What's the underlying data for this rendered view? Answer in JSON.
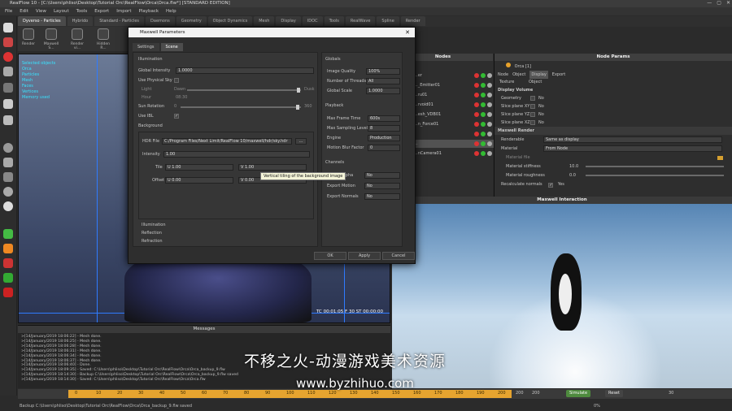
{
  "window": {
    "title": "RealFlow 10 - [C:\\Users\\phliso\\Desktop\\Tutorial Orc\\RealFlow\\Orca\\Orca.flw*] [STANDARD EDITION]",
    "controls": [
      "—",
      "▢",
      "✕"
    ]
  },
  "menu": [
    "File",
    "Edit",
    "View",
    "Layout",
    "Tools",
    "Export",
    "Import",
    "Playback",
    "Help"
  ],
  "tabs": [
    {
      "label": "Dyverso - Particles",
      "active": true
    },
    {
      "label": "Hybrido",
      "active": false
    },
    {
      "label": "Standard - Particles",
      "active": false
    },
    {
      "label": "Daemons",
      "active": false
    },
    {
      "label": "Geometry",
      "active": false
    },
    {
      "label": "Object Dynamics",
      "active": false
    },
    {
      "label": "Mesh",
      "active": false
    },
    {
      "label": "Display",
      "active": false
    },
    {
      "label": "IDOC",
      "active": false
    },
    {
      "label": "Tools",
      "active": false
    },
    {
      "label": "RealWave",
      "active": false
    },
    {
      "label": "Spline",
      "active": false
    },
    {
      "label": "Render",
      "active": false
    }
  ],
  "shelf": [
    "Render",
    "Maxwell S...",
    "Render vi...",
    "Hidden R..."
  ],
  "viewport": {
    "info_lines": [
      "Selected objects",
      "Orca",
      "Particles",
      "Mesh",
      "Faces",
      "Vertices",
      "Memory used"
    ],
    "timecode": "TC 00:01:05   F 30   ST 00:00:00"
  },
  "messages": {
    "title": "Messages",
    "lines": [
      ">[14/January/2019 18:06:22] - Mesh done.",
      ">[14/January/2019 18:06:25] - Mesh done.",
      ">[14/January/2019 18:06:28] - Mesh done.",
      ">[14/January/2019 18:06:31] - Mesh done.",
      ">[14/January/2019 18:06:34] - Mesh done.",
      ">[14/January/2019 18:06:37] - Mesh done.",
      ">[14/January/2019 18:06:40] - Done.",
      ">[14/January/2019 18:09:35] - Saved: C:\\Users\\phliso\\Desktop\\Tutorial Orc\\RealFlow\\Orca\\Orca_backup_9.flw",
      ">[14/January/2019 18:14:30] - Backup C:\\Users\\phliso\\Desktop\\Tutorial Orc\\RealFlow\\Orca\\Orca_backup_9.flw saved",
      ">[14/January/2019 18:14:30] - Saved: C:\\Users\\phliso\\Desktop\\Tutorial Orc\\RealFlow\\Orca\\Orca.flw"
    ]
  },
  "timeline": {
    "ticks": [
      "0",
      "10",
      "20",
      "30",
      "40",
      "50",
      "60",
      "70",
      "80",
      "90",
      "100",
      "110",
      "120",
      "130",
      "140",
      "150",
      "160",
      "170",
      "180",
      "190",
      "200"
    ],
    "end_labels": [
      "200",
      "200"
    ],
    "simulate_label": "Simulate",
    "reset_label": "Reset",
    "frame": "30",
    "percent": "0%"
  },
  "status": "Backup C:\\Users\\phliso\\Desktop\\Tutorial Orc\\RealFlow\\Orca\\Orca_backup_9.flw saved",
  "nodes": {
    "title": "Nodes",
    "items": [
      "...er",
      "..._Emitter01",
      "...ru01",
      "...rvoid01",
      "...esh_VDB01",
      "...n_Force01",
      "",
      "...",
      "...nCamera01"
    ],
    "selected_index": 7
  },
  "node_params": {
    "title": "Node Params",
    "node_name": "Orca [1]",
    "tabs": [
      "Node",
      "Object",
      "Display",
      "Export"
    ],
    "active_tab": "Display",
    "texture_label": "Texture",
    "texture_value": "Object",
    "rows": [
      {
        "label": "Geometry",
        "value": "No"
      },
      {
        "label": "Slice plane XY",
        "value": "No"
      },
      {
        "label": "Slice plane YZ",
        "value": "No"
      },
      {
        "label": "Slice plane XZ",
        "value": "No"
      }
    ],
    "display_volume": "Display Volume",
    "maxwell_render": "Maxwell Render",
    "renderable_label": "Renderable",
    "renderable_value": "Same as display",
    "material_label": "Material",
    "material_value": "From Node",
    "material_file_label": "Material file",
    "material_stiffness_label": "Material stiffness",
    "material_stiffness_value": "10.0",
    "material_roughness_label": "Material roughness",
    "material_roughness_value": "0.0",
    "recalculate_label": "Recalculate normals",
    "recalculate_value": "Yes"
  },
  "interaction": {
    "title": "Maxwell Interaction"
  },
  "watermark": {
    "line1": "不移之火-动漫游戏美术资源",
    "line2": "www.byzhihuo.com"
  },
  "dialog": {
    "title": "Maxwell Parameters",
    "tabs": [
      "Settings",
      "Scene"
    ],
    "active_tab": "Scene",
    "illumination": {
      "header": "Illumination",
      "global_intensity_label": "Global Intensity",
      "global_intensity_value": "1.0000",
      "physical_sky_label": "Use Physical Sky",
      "light_label": "Light",
      "dawn_label": "Dawn",
      "dusk_label": "Dusk",
      "hour_label": "Hour",
      "hour_value": "08:30",
      "sun_rotation_label": "Sun Rotation",
      "sun_rotation_min": "0",
      "sun_rotation_max": "360",
      "use_ibl_label": "Use IBL",
      "use_ibl_checked": "✓",
      "background_label": "Background",
      "hdr_file_label": "HDR File",
      "hdr_file_value": "C:/Program Files/Next Limit/RealFlow 10/maxwell/hdr/sky.hdr",
      "intensity_label": "Intensity",
      "intensity_value": "1.00",
      "tile_label": "Tile",
      "tile_u": "U 1.00",
      "tile_v": "V 1.00",
      "offset_label": "Offset",
      "offset_u": "U 0.00",
      "offset_v": "V 0.00",
      "sub_items": [
        "Illumination",
        "Reflection",
        "Refraction"
      ]
    },
    "tooltip": "Vertical tiling of the background image",
    "globals": {
      "header": "Globals",
      "image_quality_label": "Image Quality",
      "image_quality_value": "100%",
      "num_threads_label": "Number of Threads",
      "num_threads_value": "All",
      "global_scale_label": "Global Scale",
      "global_scale_value": "1.0000"
    },
    "playback": {
      "header": "Playback",
      "max_frame_time_label": "Max Frame Time",
      "max_frame_time_value": "600s",
      "max_sampling_label": "Max Sampling Level",
      "max_sampling_value": "8",
      "engine_label": "Engine",
      "engine_value": "Production",
      "motion_blur_label": "Motion Blur Factor",
      "motion_blur_value": "0"
    },
    "channels": {
      "header": "Channels",
      "alpha_label": "Export Alpha",
      "alpha_value": "No",
      "motion_label": "Export Motion",
      "motion_value": "No",
      "normals_label": "Export Normals",
      "normals_value": "No"
    },
    "buttons": {
      "ok": "OK",
      "apply": "Apply",
      "cancel": "Cancel"
    }
  }
}
